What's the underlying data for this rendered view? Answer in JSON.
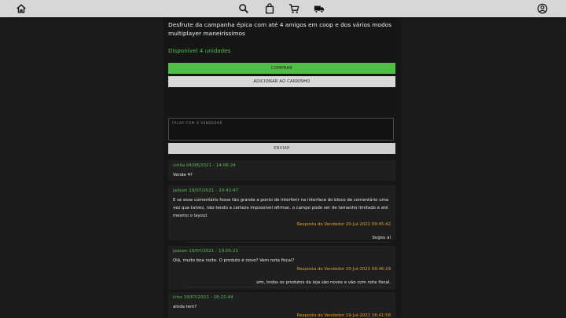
{
  "nav": {
    "icons": [
      "home-icon",
      "search-icon",
      "bag-icon",
      "cart-icon",
      "truck-icon",
      "account-icon"
    ]
  },
  "product": {
    "description": "Desfrute da campanha épica com até 4 amigos em coop e dos vários modos multiplayer maneiríssimos",
    "stock": "Disponível 4 unidades",
    "buy_label": "COMPRAR",
    "cart_label": "ADICIONAR AO CARRINHO"
  },
  "message": {
    "placeholder": "FALAR COM O VENDEDOR",
    "send_label": "ENVIAR"
  },
  "comments": [
    {
      "header": "cirilla 04/08/2021 - 14:06:24",
      "text": "Vende 4?"
    },
    {
      "header": "jadson 19/07/2021 - 20:43:47",
      "text": "E se esse comentário fosse tão grande a ponto de interferir na interface do bloco de comentário uma vez que talvez, não tendo a certeza impossível afirmar, o campo pode ser de tamanho limitado e até mesmo o layout",
      "reply_header": "Resposta do Vendedor 20-Jul-2021 09:45:42",
      "reply_text": "bugou aí"
    },
    {
      "header": "jadson 19/07/2021 - 19:05:21",
      "text": "Olá, muito boa noite. O produto é novo? Vem nota fiscal?",
      "reply_header": "Resposta do Vendedor 20-Jul-2021 09:46:29",
      "reply_text": "sim, todos os produtos da loja são novos e vão com nota fiscal."
    },
    {
      "header": "triss 19/07/2021 - 16:22:44",
      "text": "ainda tem?",
      "reply_header": "Resposta do Vendedor 19-Jul-2021 16:41:58"
    }
  ],
  "colors": {
    "accent_green": "#4fbe45",
    "reply_orange": "#e1a21f",
    "background": "#1b1b1b"
  }
}
